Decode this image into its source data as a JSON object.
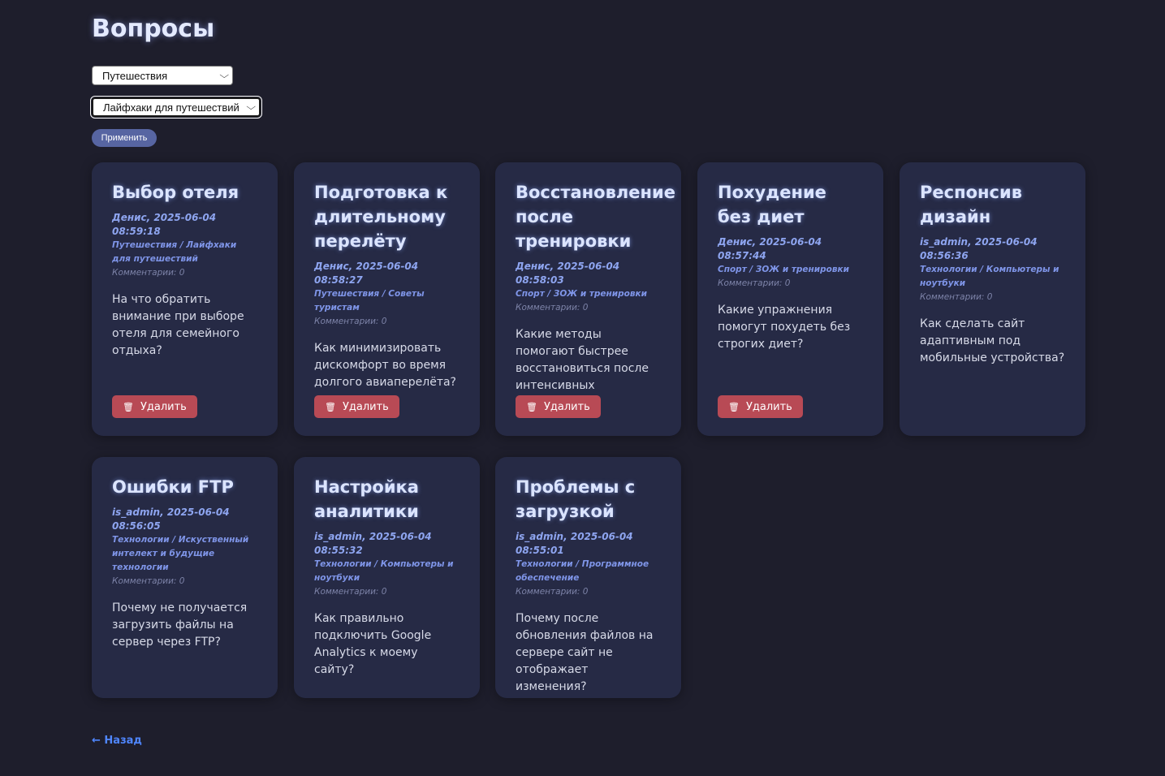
{
  "page": {
    "title": "Вопросы",
    "back": "← Назад"
  },
  "filters": {
    "category": "Путешествия",
    "subcategory": "Лайфхаки для путешествий",
    "apply": "Применить"
  },
  "delete_label": "Удалить",
  "cards": [
    {
      "title": "Выбор отеля",
      "author": "Денис, 2025-06-04 08:59:18",
      "category": "Путешествия / Лайфхаки для путешествий",
      "comments": "Комментарии: 0",
      "question": "На что обратить внимание при выборе отеля для семейного отдыха?",
      "deletable": true
    },
    {
      "title": "Подготовка к длительному перелёту",
      "author": "Денис, 2025-06-04 08:58:27",
      "category": "Путешествия / Советы туристам",
      "comments": "Комментарии: 0",
      "question": "Как минимизировать дискомфорт во время долгого авиаперелёта?",
      "deletable": true
    },
    {
      "title": "Восстановление после тренировки",
      "author": "Денис, 2025-06-04 08:58:03",
      "category": "Спорт / ЗОЖ и тренировки",
      "comments": "Комментарии: 0",
      "question": "Какие методы помогают быстрее восстановиться после интенсивных тренировок?",
      "deletable": true
    },
    {
      "title": "Похудение без диет",
      "author": "Денис, 2025-06-04 08:57:44",
      "category": "Спорт / ЗОЖ и тренировки",
      "comments": "Комментарии: 0",
      "question": "Какие упражнения помогут похудеть без строгих диет?",
      "deletable": true
    },
    {
      "title": "Респонсив дизайн",
      "author": "is_admin, 2025-06-04 08:56:36",
      "category": "Технологии / Компьютеры и ноутбуки",
      "comments": "Комментарии: 0",
      "question": "Как сделать сайт адаптивным под мобильные устройства?",
      "deletable": false
    },
    {
      "title": "Ошибки FTP",
      "author": "is_admin, 2025-06-04 08:56:05",
      "category": "Технологии / Искуственный интелект и будущие технологии",
      "comments": "Комментарии: 0",
      "question": "Почему не получается загрузить файлы на сервер через FTP?",
      "deletable": false
    },
    {
      "title": "Настройка аналитики",
      "author": "is_admin, 2025-06-04 08:55:32",
      "category": "Технологии / Компьютеры и ноутбуки",
      "comments": "Комментарии: 0",
      "question": "Как правильно подключить Google Analytics к моему сайту?",
      "deletable": false
    },
    {
      "title": "Проблемы с загрузкой",
      "author": "is_admin, 2025-06-04 08:55:01",
      "category": "Технологии / Программное обеспечение",
      "comments": "Комментарии: 0",
      "question": "Почему после обновления файлов на сервере сайт не отображает изменения?",
      "deletable": false
    }
  ]
}
